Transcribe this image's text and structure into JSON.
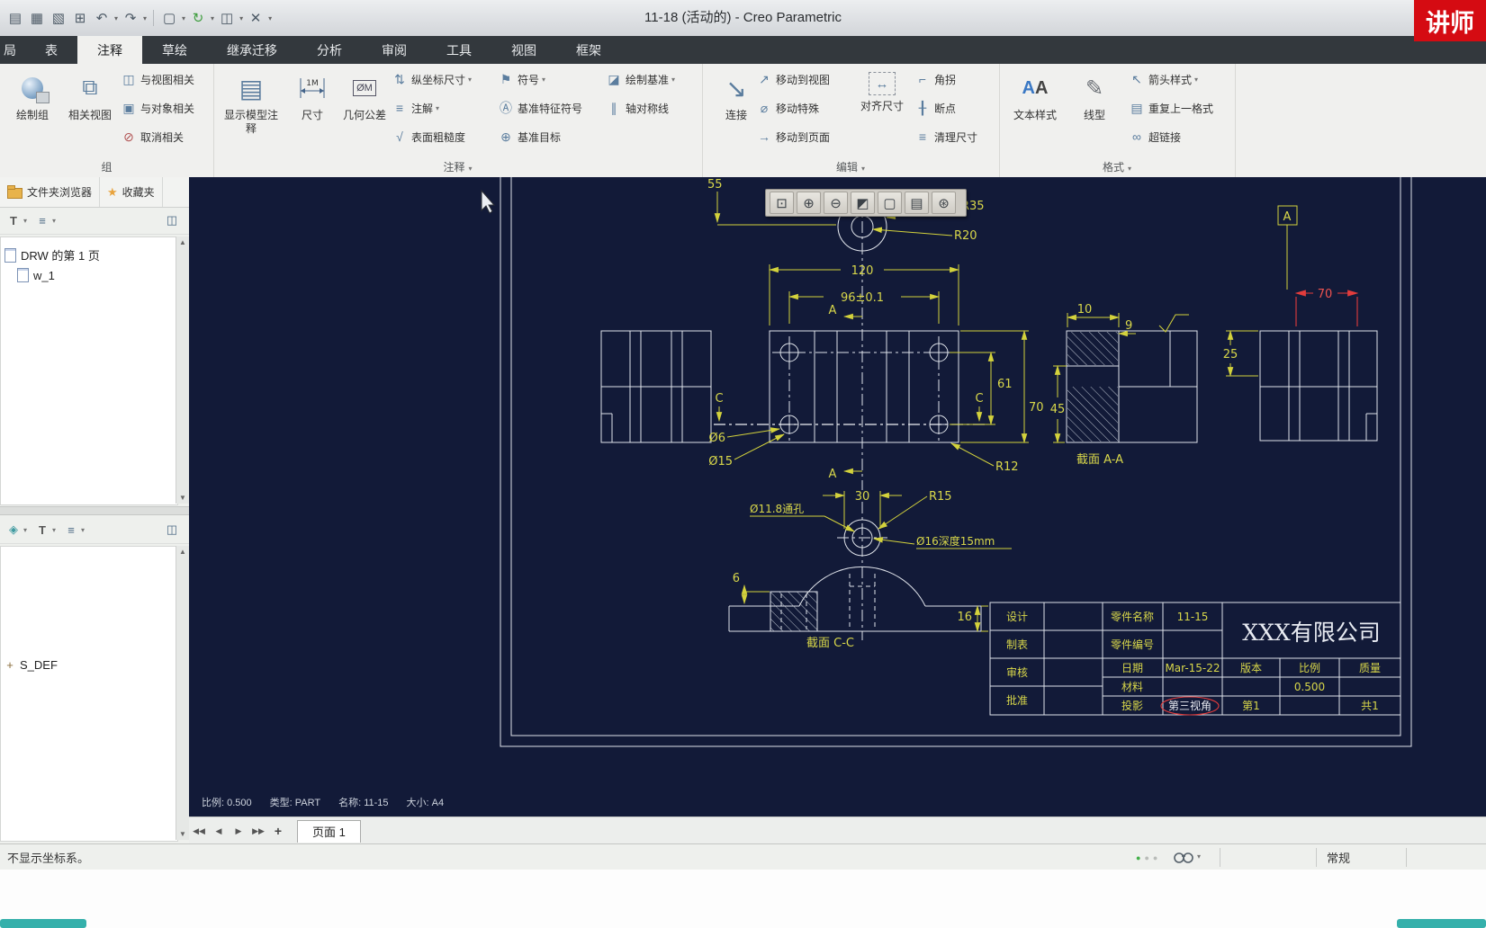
{
  "titlebar": {
    "title": "11-18 (活动的) - Creo Parametric",
    "badge": "讲师"
  },
  "tabs": [
    "局",
    "表",
    "注释",
    "草绘",
    "继承迁移",
    "分析",
    "审阅",
    "工具",
    "视图",
    "框架"
  ],
  "ribbon": {
    "group_labels": {
      "g1": "组",
      "g2": "注释",
      "g3": "编辑",
      "g4": "格式"
    },
    "g1": {
      "draw_group": "绘制组",
      "related_views": "相关视图",
      "view_related": "与视图相关",
      "object_related": "与对象相关",
      "unrelate": "取消相关"
    },
    "g2": {
      "show_model": "显示模型注释",
      "dim": "尺寸",
      "gtol": "几何公差",
      "ordinate": "纵坐标尺寸",
      "note": "注解",
      "surface": "表面粗糙度",
      "symbol": "符号",
      "datum_feature": "基准特征符号",
      "datum_target": "基准目标",
      "draft_datum": "绘制基准",
      "axis_sym": "轴对称线"
    },
    "g3": {
      "attach": "连接",
      "move_to_view": "移动到视图",
      "move_special": "移动特殊",
      "move_to_sheet": "移动到页面",
      "align_dims": "对齐尺寸",
      "jog": "角拐",
      "breakpoint": "断点",
      "cleanup_dims": "清理尺寸"
    },
    "g4": {
      "text_style": "文本样式",
      "line_style": "线型",
      "arrow_style": "箭头样式",
      "repeat_format": "重复上一格式",
      "hyperlink": "超链接"
    }
  },
  "panel": {
    "tab_folder": "文件夹浏览器",
    "tab_fav": "收藏夹",
    "tree1_item1": "DRW 的第 1 页",
    "tree1_item2": "w_1",
    "tree2_item1": "S_DEF"
  },
  "canvas_info": {
    "scale": "比例: 0.500",
    "type": "类型: PART",
    "name": "名称: 11-15",
    "size": "大小: A4"
  },
  "pagebar": {
    "tab": "页面 1"
  },
  "statusbar": {
    "message": "不显示坐标系。",
    "mode": "常规"
  },
  "drawing": {
    "dims": {
      "d55": "55",
      "r35": "R35",
      "r20": "R20",
      "d120": "120",
      "d96": "96±0.1",
      "letter_a": "A",
      "letter_c": "C",
      "d61": "61",
      "d70": "70",
      "dia6": "Ø6",
      "dia15": "Ø15",
      "r12": "R12",
      "d10": "10",
      "d9": "9",
      "d45": "45",
      "d25": "25",
      "d70_red": "70",
      "datum_a": "A",
      "d30": "30",
      "r15": "R15",
      "dia118": "Ø11.8通孔",
      "dia16": "Ø16深度15mm",
      "d6": "6",
      "d16": "16",
      "section_aa": "截面 A-A",
      "section_cc": "截面 C-C"
    },
    "titleblock": {
      "design": "设计",
      "drafted": "制表",
      "checked": "审核",
      "approved": "批准",
      "part_name_label": "零件名称",
      "part_name": "11-15",
      "part_no_label": "零件编号",
      "date_label": "日期",
      "date": "Mar-15-22",
      "version_label": "版本",
      "scale_label": "比例",
      "mass_label": "质量",
      "material_label": "材料",
      "scale_value": "0.500",
      "projection_label": "投影",
      "projection_value": "第三视角",
      "sheet_no": "第1",
      "sheet_total": "共1",
      "company": "XXX有限公司"
    }
  },
  "icons": {
    "new": "▤",
    "save": "▦",
    "save_as": "▧",
    "open": "⊞",
    "undo": "↶",
    "redo": "↷",
    "select_box": "▢",
    "regenerate": "↻",
    "windows": "◫",
    "close_window": "✕",
    "caret": "▾",
    "view_related": "◫",
    "object_related": "▣",
    "unrelate": "⊘",
    "show_model": "▤",
    "dim_icon_text": "1M",
    "gtol_icon_text": "ØM",
    "ordinate": "⇅",
    "note": "≡",
    "surface": "√",
    "symbol": "⚑",
    "datum_feature": "Ⓐ",
    "datum_target": "⊕",
    "draft_datum": "◪",
    "axis_sym": "∥",
    "attach": "↘",
    "move_to_view": "↗",
    "move_special": "⌀",
    "move_to_sheet": "→",
    "align": "↔",
    "jog": "⌐",
    "breakpoint": "╂",
    "cleanup": "≡",
    "text_style_a": "A",
    "line_style": "✎",
    "arrow_style": "↖",
    "repeat_format": "▤",
    "hyperlink": "∞",
    "ft_zoom_window": "⊡",
    "ft_zoom_in": "⊕",
    "ft_zoom_out": "⊖",
    "ft_display": "◩",
    "ft_sheet": "▢",
    "ft_print": "▤",
    "ft_refit": "⊛",
    "filter": "T",
    "list": "≡",
    "panes": "◫",
    "cube": "◈",
    "star": "★",
    "csys": "+",
    "up": "▲",
    "down": "▼",
    "nav_first": "◀◀",
    "nav_prev": "◀",
    "nav_next": "▶",
    "nav_last": "▶▶",
    "add_page": "+",
    "dot": "●"
  },
  "colors": {
    "badge_red": "#d50b12",
    "canvas_bg": "#121a38",
    "dim_yellow": "#d3d23c",
    "line_white": "#dfe3ea",
    "dim_red": "#e23c3c",
    "status_green": "#44b04a"
  }
}
